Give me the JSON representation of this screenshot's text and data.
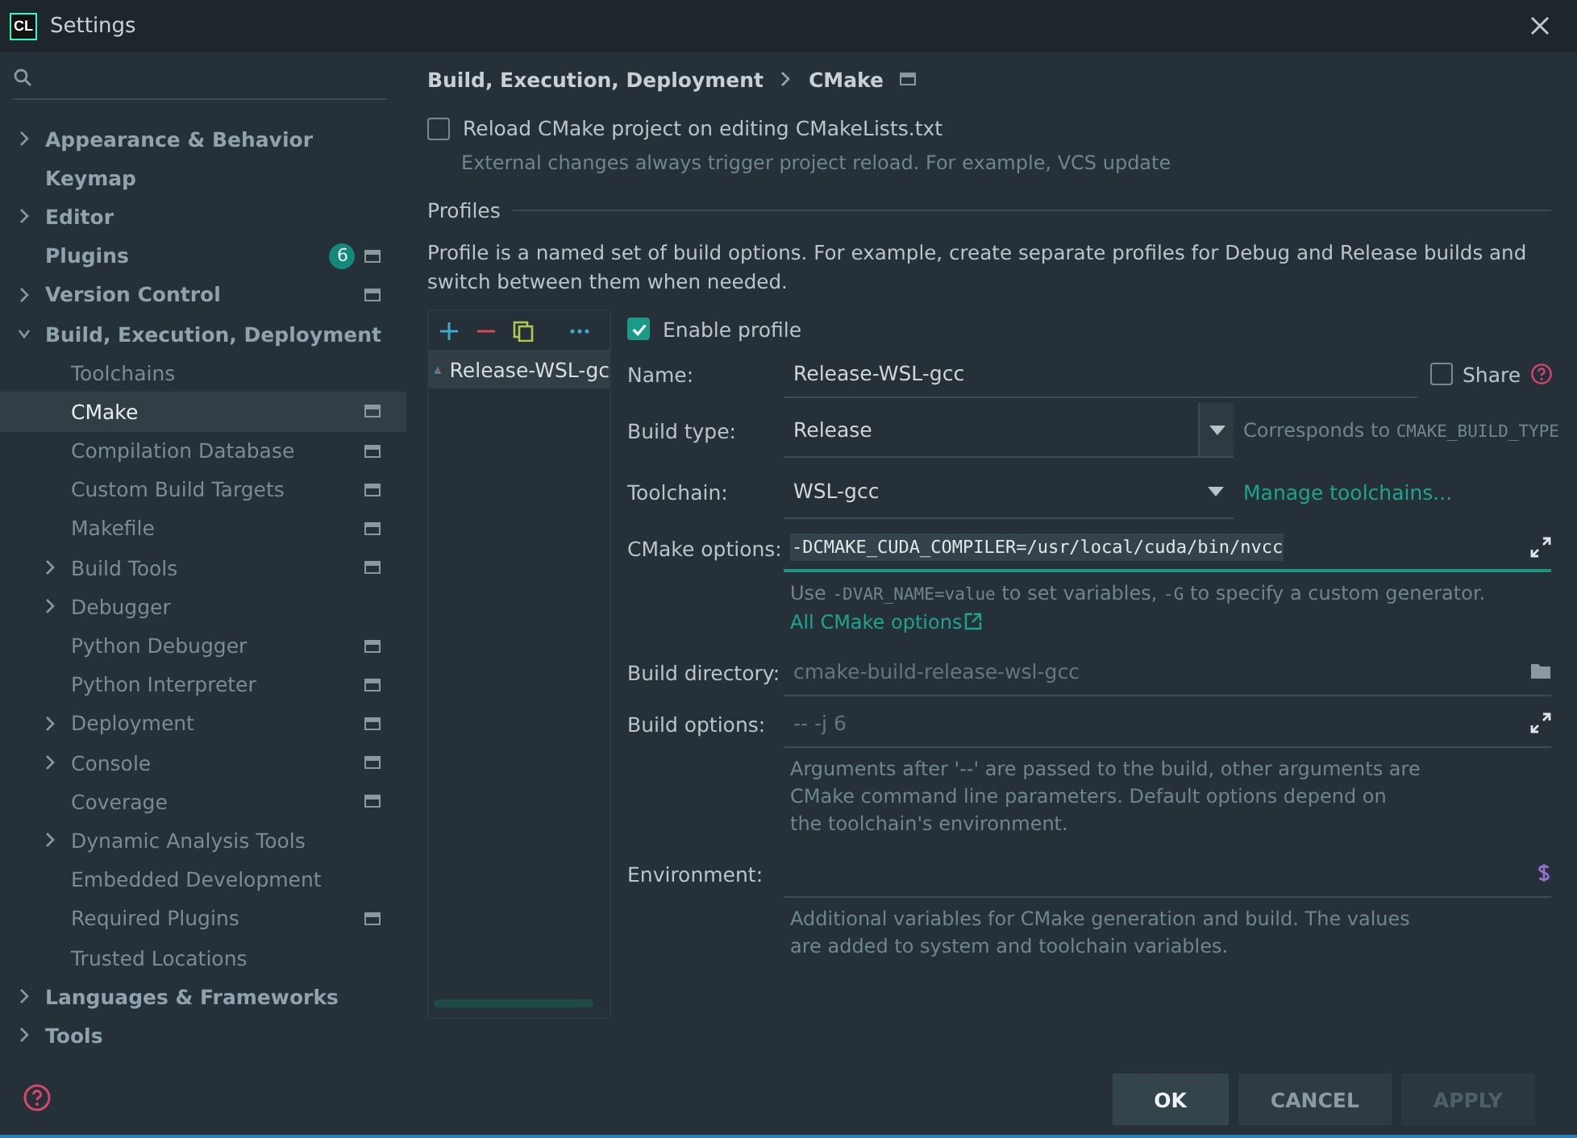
{
  "window": {
    "title": "Settings",
    "app_badge": "CL"
  },
  "sidebar": {
    "items": [
      {
        "label": "Appearance & Behavior",
        "expanded": false,
        "selected": false
      },
      {
        "label": "Keymap",
        "selected": false
      },
      {
        "label": "Editor",
        "expanded": false,
        "selected": false
      },
      {
        "label": "Plugins",
        "selected": false,
        "badge": "6",
        "project_scope": true
      },
      {
        "label": "Version Control",
        "expanded": false,
        "selected": false,
        "project_scope": true
      },
      {
        "label": "Build, Execution, Deployment",
        "expanded": true,
        "selected": false,
        "children": [
          {
            "label": "Toolchains",
            "selected": false
          },
          {
            "label": "CMake",
            "selected": true,
            "project_scope": true
          },
          {
            "label": "Compilation Database",
            "selected": false,
            "project_scope": true
          },
          {
            "label": "Custom Build Targets",
            "selected": false,
            "project_scope": true
          },
          {
            "label": "Makefile",
            "selected": false,
            "project_scope": true
          },
          {
            "label": "Build Tools",
            "expanded": false,
            "selected": false,
            "project_scope": true
          },
          {
            "label": "Debugger",
            "expanded": false,
            "selected": false
          },
          {
            "label": "Python Debugger",
            "selected": false,
            "project_scope": true
          },
          {
            "label": "Python Interpreter",
            "selected": false,
            "project_scope": true
          },
          {
            "label": "Deployment",
            "expanded": false,
            "selected": false,
            "project_scope": true
          },
          {
            "label": "Console",
            "expanded": false,
            "selected": false,
            "project_scope": true
          },
          {
            "label": "Coverage",
            "selected": false,
            "project_scope": true
          },
          {
            "label": "Dynamic Analysis Tools",
            "expanded": false,
            "selected": false
          },
          {
            "label": "Embedded Development",
            "selected": false
          },
          {
            "label": "Required Plugins",
            "selected": false,
            "project_scope": true
          },
          {
            "label": "Trusted Locations",
            "selected": false
          }
        ]
      },
      {
        "label": "Languages & Frameworks",
        "expanded": false,
        "selected": false
      },
      {
        "label": "Tools",
        "expanded": false,
        "selected": false
      }
    ]
  },
  "breadcrumb": [
    "Build, Execution, Deployment",
    "CMake"
  ],
  "reload_option": {
    "label": "Reload CMake project on editing CMakeLists.txt",
    "checked": false,
    "hint": "External changes always trigger project reload. For example, VCS update"
  },
  "profiles_section": {
    "title": "Profiles",
    "description": "Profile is a named set of build options. For example, create separate profiles for Debug and Release builds and switch between them when needed."
  },
  "profiles": [
    {
      "name": "Release-WSL-gc",
      "selected": true
    }
  ],
  "profile_form": {
    "enable_profile": {
      "label": "Enable profile",
      "checked": true
    },
    "name": {
      "label": "Name:",
      "value": "Release-WSL-gcc"
    },
    "share": {
      "label": "Share",
      "checked": false
    },
    "build_type": {
      "label": "Build type:",
      "value": "Release",
      "note": "Corresponds to",
      "note_code": "CMAKE_BUILD_TYPE"
    },
    "toolchain": {
      "label": "Toolchain:",
      "value": "WSL-gcc",
      "link": "Manage toolchains..."
    },
    "cmake_options": {
      "label": "CMake options:",
      "value": "-DCMAKE_CUDA_COMPILER=/usr/local/cuda/bin/nvcc",
      "hint": [
        {
          "text": "Use ",
          "code": false
        },
        {
          "text": "-DVAR_NAME=value",
          "code": true
        },
        {
          "text": " to set variables, ",
          "code": false
        },
        {
          "text": "-G",
          "code": true
        },
        {
          "text": " to specify a custom generator.",
          "code": false
        }
      ],
      "link": "All CMake options"
    },
    "build_directory": {
      "label": "Build directory:",
      "placeholder": "cmake-build-release-wsl-gcc"
    },
    "build_options": {
      "label": "Build options:",
      "placeholder": "-- -j 6",
      "hint": "Arguments after '--' are passed to the build, other arguments are CMake command line parameters. Default options depend on the toolchain's environment."
    },
    "environment": {
      "label": "Environment:",
      "hint": "Additional variables for CMake generation and build. The values are added to system and toolchain variables."
    }
  },
  "buttons": [
    {
      "label": "OK",
      "kind": "default",
      "disabled": false
    },
    {
      "label": "CANCEL",
      "kind": "normal",
      "disabled": false
    },
    {
      "label": "APPLY",
      "kind": "normal",
      "disabled": true
    }
  ]
}
